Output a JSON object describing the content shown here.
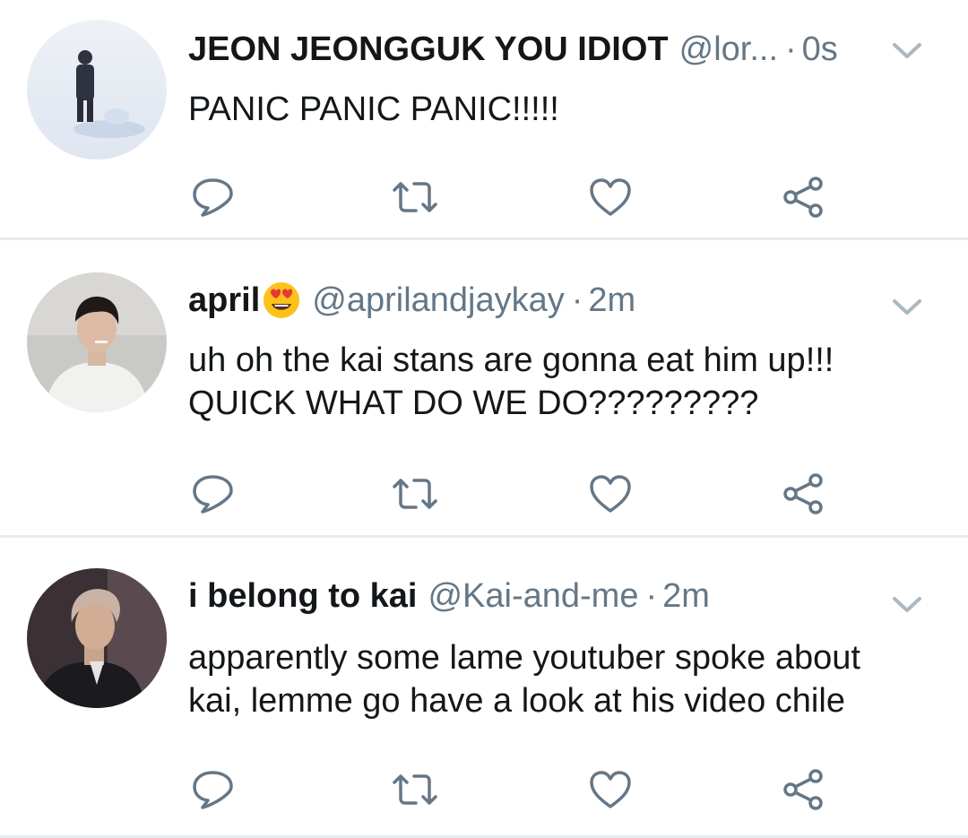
{
  "timeline": {
    "tweets": [
      {
        "display_name": "JEON JEONGGUK YOU IDIOT",
        "handle": "@lor...",
        "separator": "·",
        "time": "0s",
        "text_lines": [
          "PANIC PANIC PANIC!!!!!"
        ],
        "avatar": "person-in-snow-avatar"
      },
      {
        "display_name": "april",
        "emoji": "heart-eyes-emoji",
        "handle": "@aprilandjaykay",
        "separator": "·",
        "time": "2m",
        "text_lines": [
          "uh oh the kai stans are gonna eat him up!!!",
          "QUICK WHAT DO WE DO?????????"
        ],
        "avatar": "young-man-avatar"
      },
      {
        "display_name": "i belong to kai",
        "handle": "@Kai-and-me",
        "separator": "·",
        "time": "2m",
        "text_lines": [
          "apparently some lame youtuber spoke about",
          "kai, lemme go have a look at his video chile"
        ],
        "avatar": "kai-avatar"
      }
    ]
  },
  "icons": {
    "reply": "reply-icon",
    "retweet": "retweet-icon",
    "like": "heart-icon",
    "share": "share-icon",
    "more": "chevron-down-icon"
  },
  "colors": {
    "icon": "#657786",
    "text": "#14171a",
    "secondary": "#657786",
    "divider": "#e6ecf0"
  }
}
